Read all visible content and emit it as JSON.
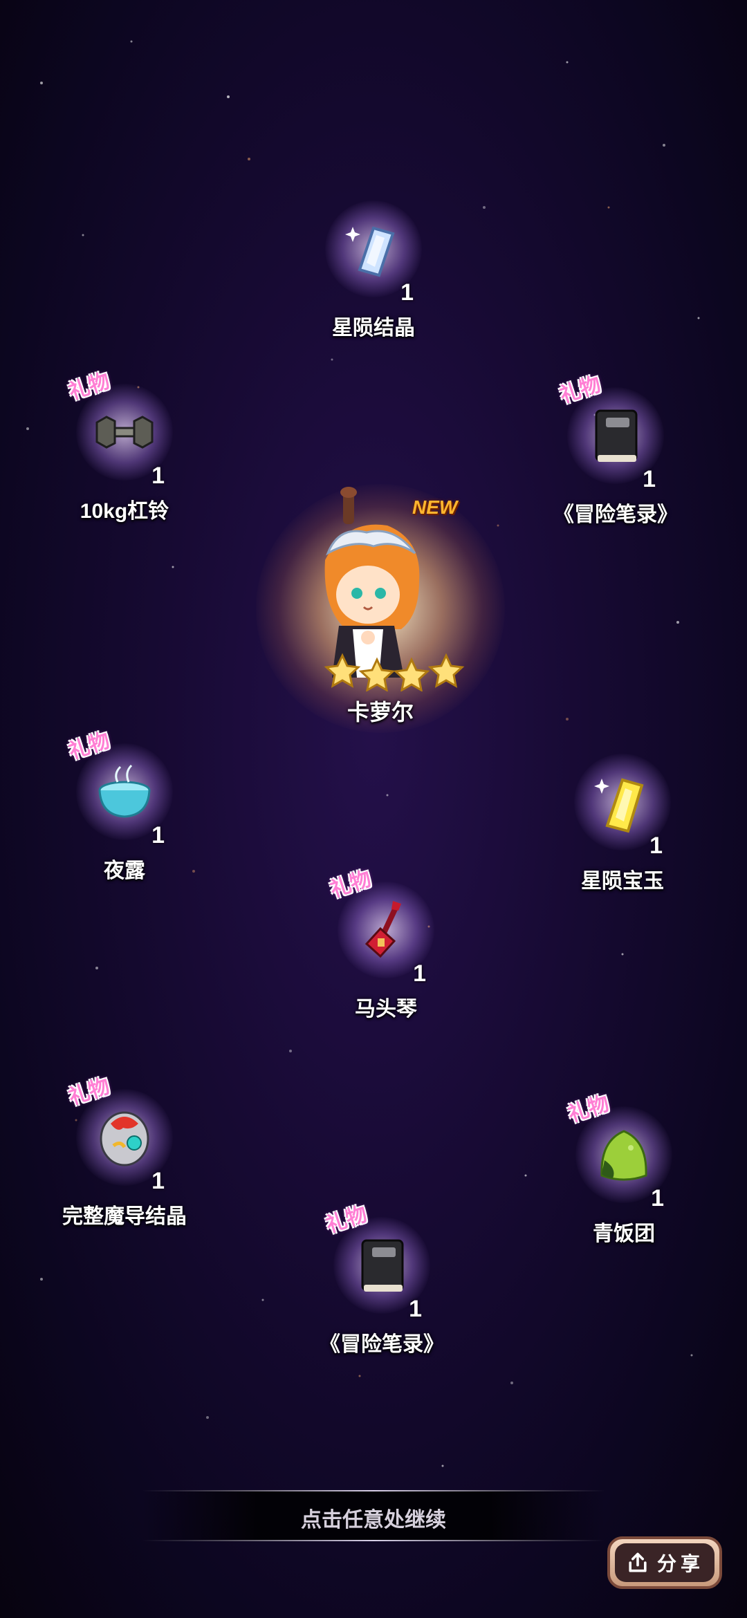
{
  "hero": {
    "name": "卡萝尔",
    "badge": "NEW",
    "stars": 4
  },
  "gift_tag": "礼物",
  "items": [
    {
      "id": "star-crystal",
      "name": "星陨结晶",
      "count": "1",
      "gift": false,
      "icon": "blue-crystal-icon"
    },
    {
      "id": "dumbbell",
      "name": "10kg杠铃",
      "count": "1",
      "gift": true,
      "icon": "dumbbell-icon"
    },
    {
      "id": "adventure-notes-1",
      "name": "《冒险笔录》",
      "count": "1",
      "gift": true,
      "icon": "black-book-icon"
    },
    {
      "id": "night-dew",
      "name": "夜露",
      "count": "1",
      "gift": true,
      "icon": "dew-bowl-icon"
    },
    {
      "id": "star-gem",
      "name": "星陨宝玉",
      "count": "1",
      "gift": false,
      "icon": "yellow-gem-icon"
    },
    {
      "id": "morin-khuur",
      "name": "马头琴",
      "count": "1",
      "gift": true,
      "icon": "horsehead-fiddle-icon"
    },
    {
      "id": "magic-crystal",
      "name": "完整魔导结晶",
      "count": "1",
      "gift": true,
      "icon": "magic-orb-icon"
    },
    {
      "id": "rice-ball",
      "name": "青饭团",
      "count": "1",
      "gift": true,
      "icon": "green-riceball-icon"
    },
    {
      "id": "adventure-notes-2",
      "name": "《冒险笔录》",
      "count": "1",
      "gift": true,
      "icon": "black-book-icon"
    }
  ],
  "continue_text": "点击任意处继续",
  "share": {
    "label": "分享",
    "icon": "share-upload-icon"
  },
  "colors": {
    "gift_tag": "#ff7fd4",
    "new_badge": "#ffb52e",
    "background": "#170a33"
  }
}
